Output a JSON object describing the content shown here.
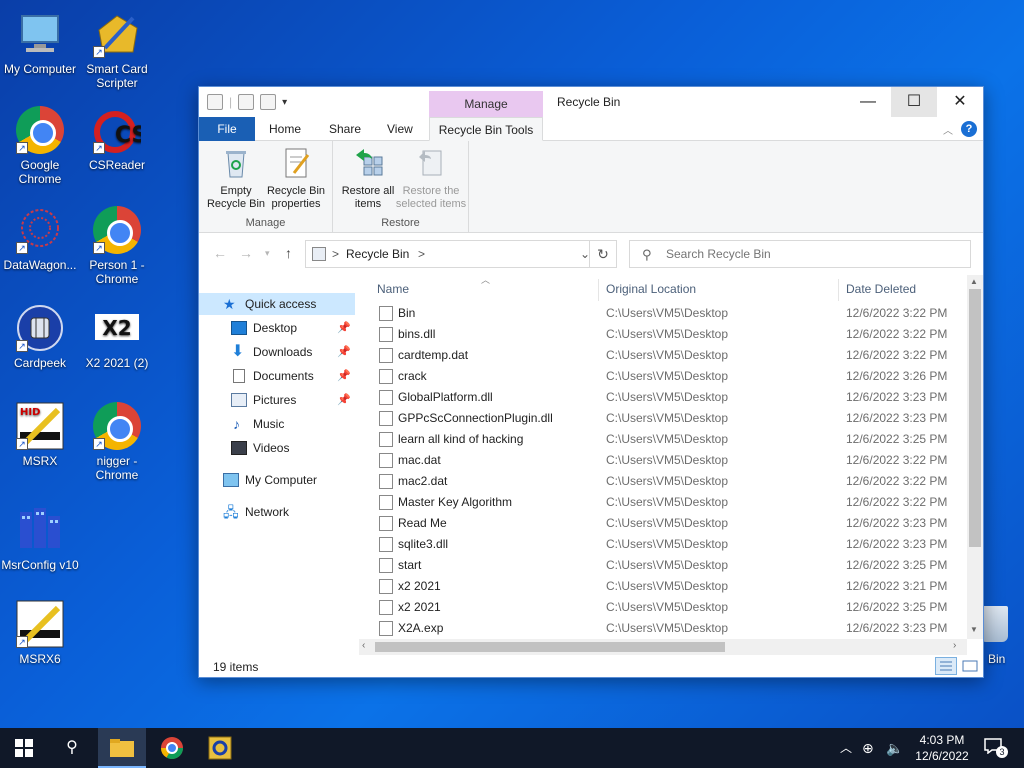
{
  "desktop": {
    "icons": [
      {
        "label": "My Computer"
      },
      {
        "label": "Smart Card Scripter"
      },
      {
        "label": "Google Chrome"
      },
      {
        "label": "CSReader"
      },
      {
        "label": "DataWagon..."
      },
      {
        "label": "Person 1 - Chrome"
      },
      {
        "label": "Cardpeek"
      },
      {
        "label": "X2 2021 (2)"
      },
      {
        "label": "MSRX"
      },
      {
        "label": "nigger - Chrome"
      },
      {
        "label": "MsrConfig v10"
      },
      {
        "label": "MSRX6"
      }
    ],
    "recycle_bin_partial_label": "Bin",
    "x2_logo_text": "X2",
    "cs_logo_text": "CS",
    "hid_logo_text": "HID"
  },
  "window": {
    "title": "Recycle Bin",
    "context_tab_header": "Manage",
    "minimize": "—",
    "maximize": "☐",
    "close": "✕"
  },
  "ribbon_tabs": {
    "file": "File",
    "home": "Home",
    "share": "Share",
    "view": "View",
    "recycle_bin_tools": "Recycle Bin Tools",
    "help": "?"
  },
  "ribbon": {
    "manage_group": {
      "label": "Manage",
      "empty": "Empty Recycle Bin",
      "properties": "Recycle Bin properties"
    },
    "restore_group": {
      "label": "Restore",
      "restore_all": "Restore all items",
      "restore_selected": "Restore the selected items"
    }
  },
  "address": {
    "path": "Recycle Bin",
    "sep": ">",
    "search_placeholder": "Search Recycle Bin"
  },
  "nav_pane": {
    "items": [
      {
        "label": "Quick access"
      },
      {
        "label": "Desktop"
      },
      {
        "label": "Downloads"
      },
      {
        "label": "Documents"
      },
      {
        "label": "Pictures"
      },
      {
        "label": "Music"
      },
      {
        "label": "Videos"
      },
      {
        "label": "My Computer"
      },
      {
        "label": "Network"
      }
    ]
  },
  "columns": {
    "name": "Name",
    "location": "Original Location",
    "date": "Date Deleted"
  },
  "files": [
    {
      "name": "Bin",
      "location": "C:\\Users\\VM5\\Desktop",
      "date": "12/6/2022 3:22 PM"
    },
    {
      "name": "bins.dll",
      "location": "C:\\Users\\VM5\\Desktop",
      "date": "12/6/2022 3:22 PM"
    },
    {
      "name": "cardtemp.dat",
      "location": "C:\\Users\\VM5\\Desktop",
      "date": "12/6/2022 3:22 PM"
    },
    {
      "name": "crack",
      "location": "C:\\Users\\VM5\\Desktop",
      "date": "12/6/2022 3:26 PM"
    },
    {
      "name": "GlobalPlatform.dll",
      "location": "C:\\Users\\VM5\\Desktop",
      "date": "12/6/2022 3:23 PM"
    },
    {
      "name": "GPPcScConnectionPlugin.dll",
      "location": "C:\\Users\\VM5\\Desktop",
      "date": "12/6/2022 3:23 PM"
    },
    {
      "name": "learn all kind of hacking",
      "location": "C:\\Users\\VM5\\Desktop",
      "date": "12/6/2022 3:25 PM"
    },
    {
      "name": "mac.dat",
      "location": "C:\\Users\\VM5\\Desktop",
      "date": "12/6/2022 3:22 PM"
    },
    {
      "name": "mac2.dat",
      "location": "C:\\Users\\VM5\\Desktop",
      "date": "12/6/2022 3:22 PM"
    },
    {
      "name": "Master Key Algorithm",
      "location": "C:\\Users\\VM5\\Desktop",
      "date": "12/6/2022 3:22 PM"
    },
    {
      "name": "Read Me",
      "location": "C:\\Users\\VM5\\Desktop",
      "date": "12/6/2022 3:23 PM"
    },
    {
      "name": "sqlite3.dll",
      "location": "C:\\Users\\VM5\\Desktop",
      "date": "12/6/2022 3:23 PM"
    },
    {
      "name": "start",
      "location": "C:\\Users\\VM5\\Desktop",
      "date": "12/6/2022 3:25 PM"
    },
    {
      "name": "x2 2021",
      "location": "C:\\Users\\VM5\\Desktop",
      "date": "12/6/2022 3:21 PM"
    },
    {
      "name": "x2 2021",
      "location": "C:\\Users\\VM5\\Desktop",
      "date": "12/6/2022 3:25 PM"
    },
    {
      "name": "X2A.exp",
      "location": "C:\\Users\\VM5\\Desktop",
      "date": "12/6/2022 3:23 PM"
    }
  ],
  "status": {
    "count": "19 items"
  },
  "taskbar": {
    "time": "4:03 PM",
    "date": "12/6/2022",
    "notifications": "3"
  },
  "colors": {
    "accent": "#1a5fb4",
    "manage_tab": "#e9c8f0",
    "selection": "#cce8ff",
    "taskbar": "#101828"
  }
}
